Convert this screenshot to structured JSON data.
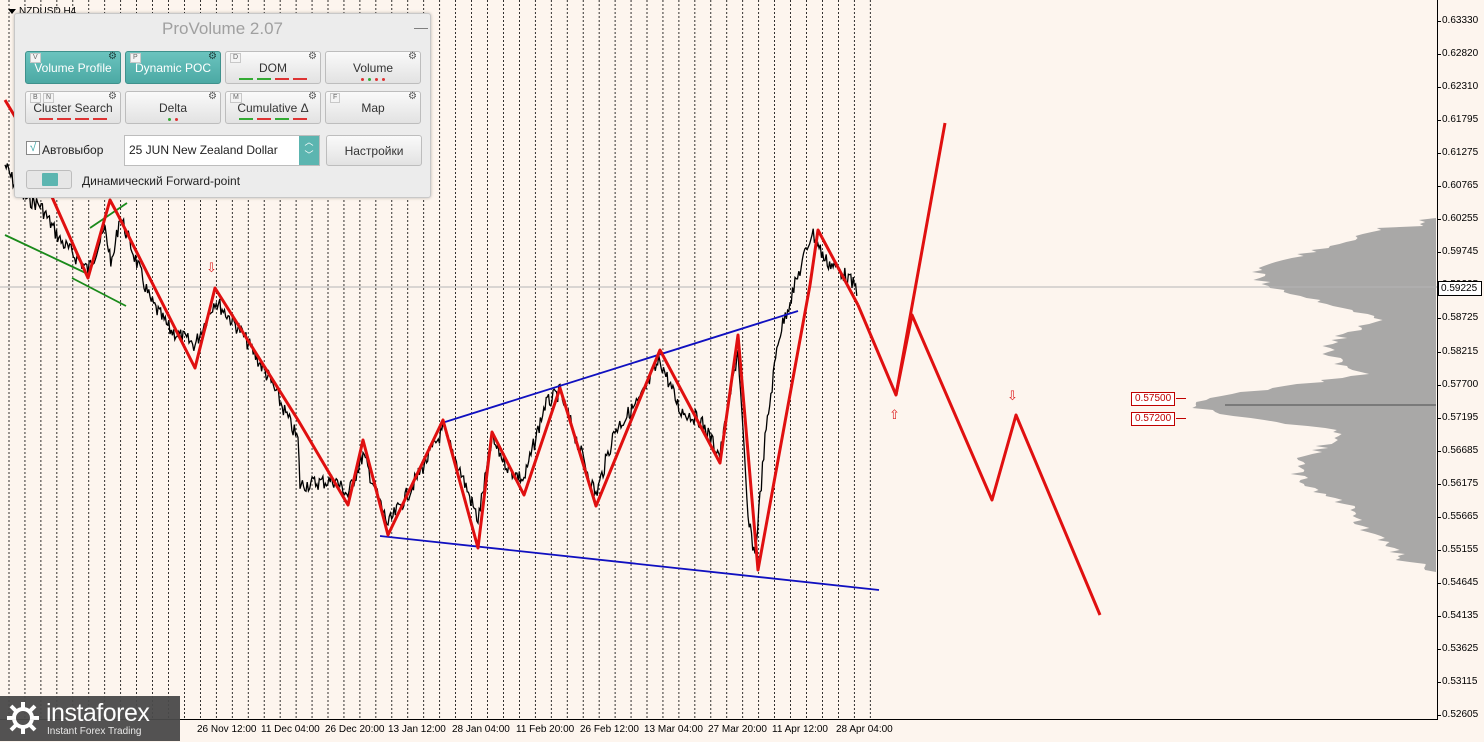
{
  "chart": {
    "symbol": "NZDUSD,H4",
    "current_price": "0.59225",
    "price_ticks": [
      "0.63330",
      "0.62820",
      "0.62310",
      "0.61795",
      "0.61275",
      "0.60765",
      "0.60255",
      "0.59745",
      "0.59225",
      "0.58725",
      "0.58215",
      "0.57700",
      "0.57195",
      "0.56685",
      "0.56175",
      "0.55665",
      "0.55155",
      "0.54645",
      "0.54135",
      "0.53625",
      "0.53115",
      "0.52605"
    ],
    "time_ticks": [
      "26 Nov 12:00",
      "11 Dec 04:00",
      "26 Dec 20:00",
      "13 Jan 12:00",
      "28 Jan 04:00",
      "11 Feb 20:00",
      "26 Feb 12:00",
      "13 Mar 04:00",
      "27 Mar 20:00",
      "11 Apr 12:00",
      "28 Apr 04:00"
    ],
    "levels": [
      {
        "label": "0.57500"
      },
      {
        "label": "0.57200"
      }
    ],
    "colors": {
      "background": "#fdf5ee",
      "zigzag": "#e01010",
      "channel": "#1010c0",
      "trend_green": "#1a8a1a",
      "price_line": "#000000",
      "volume_profile": "#9a9a9a",
      "level": "#c00000"
    },
    "arrows": [
      "down-arrow-icon",
      "up-arrow-icon",
      "down-arrow-icon"
    ]
  },
  "panel": {
    "title": "ProVolume 2.07",
    "minimize": "—",
    "buttons": [
      {
        "label": "Volume Profile",
        "key": "V",
        "active": true
      },
      {
        "label": "Dynamic POC",
        "key": "P",
        "active": true
      },
      {
        "label": "DOM",
        "key": "D",
        "active": false
      },
      {
        "label": "Volume",
        "key": "",
        "active": false
      },
      {
        "label": "Cluster Search",
        "key": "B",
        "key2": "N",
        "active": false
      },
      {
        "label": "Delta",
        "key": "",
        "active": false
      },
      {
        "label": "Cumulative Δ",
        "key": "M",
        "active": false
      },
      {
        "label": "Map",
        "key": "F",
        "active": false
      }
    ],
    "autoselect_label": "Автовыбор",
    "autoselect_checked": "√",
    "instrument": "25 JUN New Zealand Dollar",
    "settings_label": "Настройки",
    "forward_point_label": "Динамический Forward-point"
  },
  "watermark": {
    "name": "instaforex",
    "sub": "Instant Forex Trading"
  }
}
